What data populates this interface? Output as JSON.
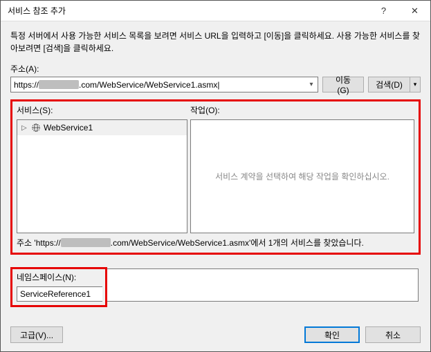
{
  "titlebar": {
    "title": "서비스 참조 추가",
    "help": "?",
    "close": "✕"
  },
  "instructions": "특정 서버에서 사용 가능한 서비스 목록을 보려면 서비스 URL을 입력하고 [이동]을 클릭하세요. 사용 가능한 서비스를 찾아보려면 [검색]을 클릭하세요.",
  "address": {
    "label": "주소(A):",
    "prefix": "https://",
    "suffix": ".com/WebService/WebService1.asmx",
    "cursor": "|"
  },
  "buttons": {
    "go": "이동(G)",
    "search": "검색(D)",
    "advanced": "고급(V)...",
    "ok": "확인",
    "cancel": "취소"
  },
  "services": {
    "label": "서비스(S):",
    "item": "WebService1"
  },
  "operations": {
    "label": "작업(O):",
    "placeholder": "서비스 계약을 선택하여 해당 작업을 확인하십시오."
  },
  "status": {
    "prefix": "주소 'https://",
    "suffix": ".com/WebService/WebService1.asmx'에서 1개의 서비스를 찾았습니다."
  },
  "namespace": {
    "label": "네임스페이스(N):",
    "value": "ServiceReference1"
  }
}
